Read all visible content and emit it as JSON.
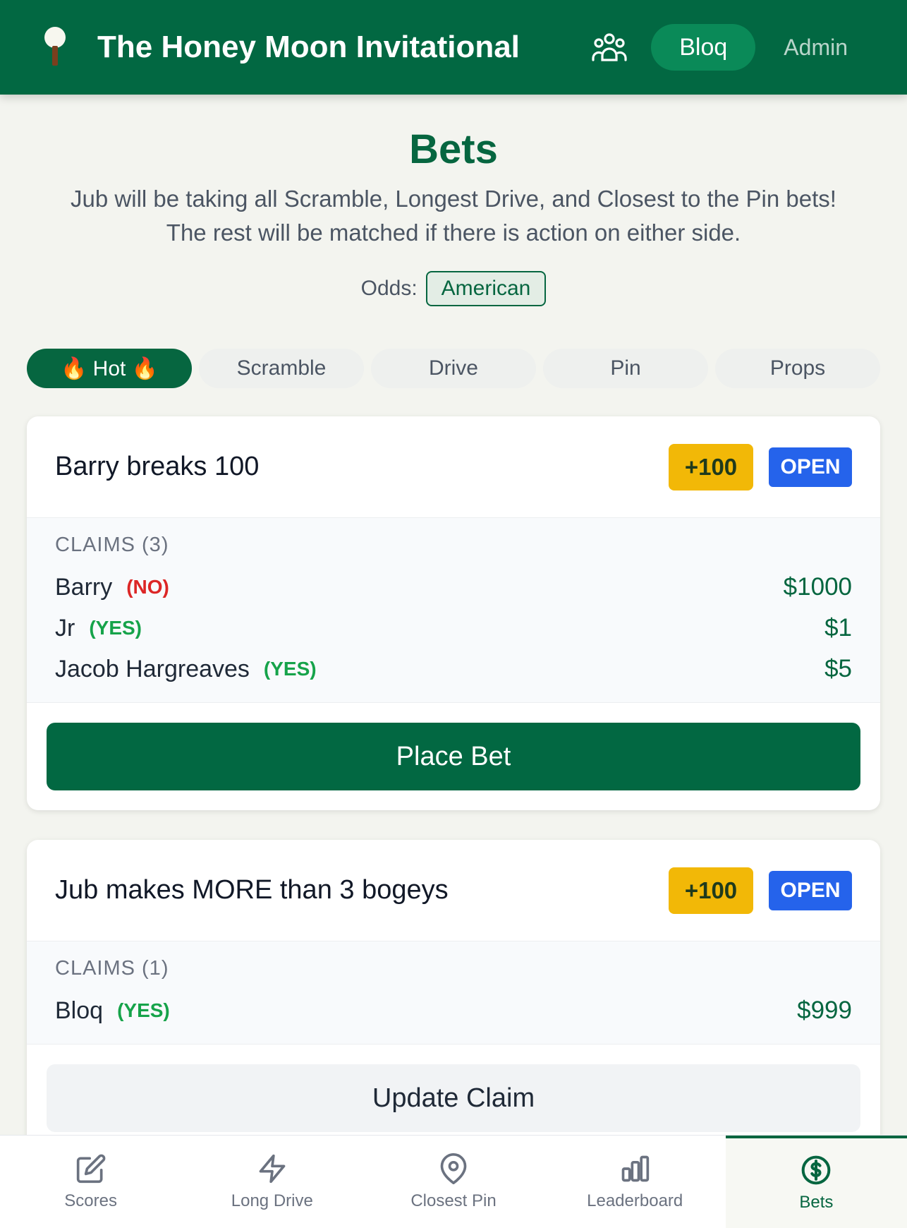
{
  "header": {
    "app_title": "The Honey Moon Invitational",
    "user_label": "Bloq",
    "admin_label": "Admin",
    "icons": [
      "golf-tee-icon",
      "users-icon"
    ]
  },
  "page": {
    "title": "Bets",
    "subtitle_line1": "Jub will be taking all Scramble, Longest Drive, and Closest to the Pin bets!",
    "subtitle_line2": "The rest will be matched if there is action on either side.",
    "odds_label": "Odds:",
    "odds_value": "American"
  },
  "tabs": [
    {
      "label": "🔥 Hot 🔥",
      "active": true
    },
    {
      "label": "Scramble",
      "active": false
    },
    {
      "label": "Drive",
      "active": false
    },
    {
      "label": "Pin",
      "active": false
    },
    {
      "label": "Props",
      "active": false
    }
  ],
  "bets": [
    {
      "title": "Barry breaks 100",
      "odds": "+100",
      "status": "OPEN",
      "claims_label": "CLAIMS (3)",
      "claims": [
        {
          "name": "Barry",
          "side": "(NO)",
          "amount": "$1000"
        },
        {
          "name": "Jr",
          "side": "(YES)",
          "amount": "$1"
        },
        {
          "name": "Jacob Hargreaves",
          "side": "(YES)",
          "amount": "$5"
        }
      ],
      "action": "Place Bet"
    },
    {
      "title": "Jub makes MORE than 3 bogeys",
      "odds": "+100",
      "status": "OPEN",
      "claims_label": "CLAIMS (1)",
      "claims": [
        {
          "name": "Bloq",
          "side": "(YES)",
          "amount": "$999"
        }
      ],
      "action": "Update Claim"
    }
  ],
  "nav": [
    {
      "label": "Scores",
      "icon": "edit-icon",
      "active": false
    },
    {
      "label": "Long Drive",
      "icon": "lightning-icon",
      "active": false
    },
    {
      "label": "Closest Pin",
      "icon": "map-pin-icon",
      "active": false
    },
    {
      "label": "Leaderboard",
      "icon": "bar-chart-icon",
      "active": false
    },
    {
      "label": "Bets",
      "icon": "dollar-circle-icon",
      "active": true
    }
  ],
  "colors": {
    "brand_green": "#026842",
    "accent_gold": "#f2b807",
    "open_blue": "#2563eb",
    "no_red": "#dc2626",
    "yes_green": "#16a34a"
  }
}
